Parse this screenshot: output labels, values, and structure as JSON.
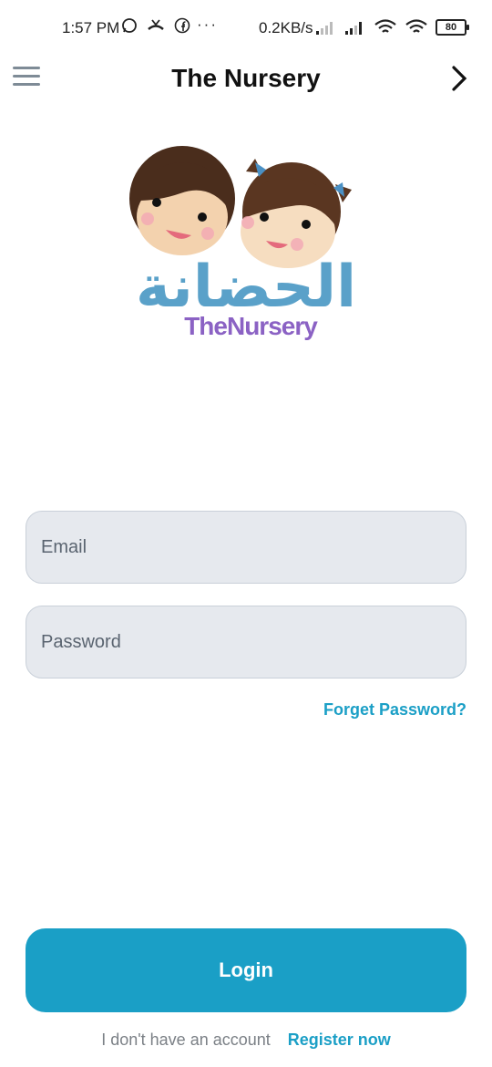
{
  "status_bar": {
    "time": "1:57 PM",
    "dots": "···",
    "network_speed": "0.2KB/s",
    "battery": "80",
    "icons": [
      "whatsapp-icon",
      "missed-call-icon",
      "facebook-icon",
      "signal-icon",
      "signal-icon",
      "wifi-icon",
      "wifi-icon",
      "battery-icon"
    ]
  },
  "header": {
    "title": "The Nursery",
    "menu_icon": "hamburger-menu-icon",
    "next_icon": "chevron-right-icon"
  },
  "logo": {
    "text_arabic": "الحضانة",
    "text_english": "TheNursery"
  },
  "form": {
    "email_placeholder": "Email",
    "password_placeholder": "Password",
    "forgot_password": "Forget Password?",
    "login_label": "Login",
    "no_account_text": "I don't have an account",
    "register_label": "Register now"
  },
  "colors": {
    "accent": "#1a9fc6",
    "field_bg": "#e6e9ee",
    "logo_text": "#5aa1c9",
    "logo_purple": "#8b62c4"
  }
}
